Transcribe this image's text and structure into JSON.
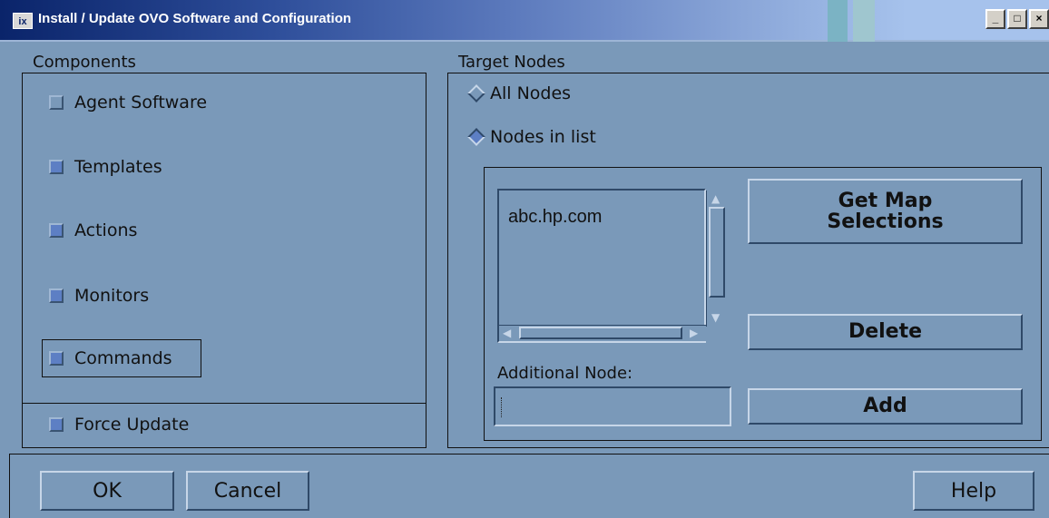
{
  "window": {
    "title": "Install / Update OVO Software and Configuration",
    "app_icon": "ix",
    "controls": [
      "minimize",
      "maximize",
      "close"
    ]
  },
  "components": {
    "label": "Components",
    "items": [
      {
        "label": "Agent Software",
        "checked": false
      },
      {
        "label": "Templates",
        "checked": true
      },
      {
        "label": "Actions",
        "checked": true
      },
      {
        "label": "Monitors",
        "checked": true
      },
      {
        "label": "Commands",
        "checked": true,
        "focused": true
      }
    ],
    "force_update": {
      "label": "Force Update",
      "checked": true
    }
  },
  "target": {
    "label": "Target Nodes",
    "radios": [
      {
        "label": "All Nodes",
        "selected": false
      },
      {
        "label": "Nodes in list",
        "selected": true
      }
    ],
    "nodes": [
      "abc.hp.com"
    ],
    "get_map_selections_label": "Get Map\nSelections",
    "delete_label": "Delete",
    "additional_node_label": "Additional Node:",
    "additional_node_value": "",
    "add_label": "Add"
  },
  "dialog_buttons": {
    "ok": "OK",
    "cancel": "Cancel",
    "help": "Help"
  },
  "colors": {
    "background": "#7a99b9",
    "titlebar": "#0a246a",
    "check_fill": "#5d7fc4"
  }
}
